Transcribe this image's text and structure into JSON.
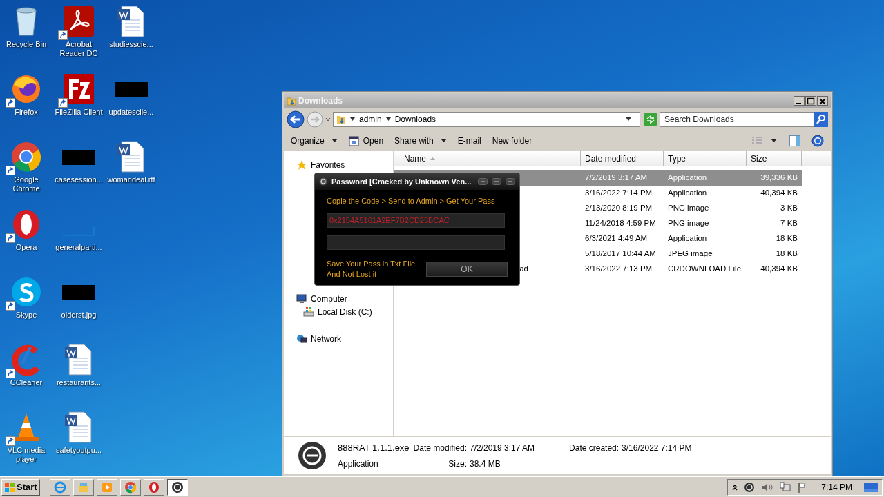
{
  "desktop": {
    "columns": [
      [
        {
          "label": "Recycle Bin",
          "kind": "recycle",
          "shortcut": false
        },
        {
          "label": "Firefox",
          "kind": "firefox",
          "shortcut": true
        },
        {
          "label": "Google Chrome",
          "kind": "chrome",
          "shortcut": true
        },
        {
          "label": "Opera",
          "kind": "opera",
          "shortcut": true
        },
        {
          "label": "Skype",
          "kind": "skype",
          "shortcut": true
        },
        {
          "label": "CCleaner",
          "kind": "ccleaner",
          "shortcut": true
        },
        {
          "label": "VLC media player",
          "kind": "vlc",
          "shortcut": true
        }
      ],
      [
        {
          "label": "Acrobat Reader DC",
          "kind": "pdf",
          "shortcut": true
        },
        {
          "label": "FileZilla Client",
          "kind": "filezilla",
          "shortcut": true
        },
        {
          "label": "casesession...",
          "kind": "redacted",
          "shortcut": false
        },
        {
          "label": "generalparti...",
          "kind": "blank",
          "shortcut": false
        },
        {
          "label": "olderst.jpg",
          "kind": "redacted",
          "shortcut": false
        },
        {
          "label": "restaurants...",
          "kind": "word",
          "shortcut": false
        },
        {
          "label": "safetyoutpu...",
          "kind": "word",
          "shortcut": false
        }
      ],
      [
        {
          "label": "studiesscie...",
          "kind": "word",
          "shortcut": false
        },
        {
          "label": "updatesclie...",
          "kind": "redacted",
          "shortcut": false
        },
        {
          "label": "womandeal.rtf",
          "kind": "word",
          "shortcut": false
        }
      ]
    ]
  },
  "explorer": {
    "title": "Downloads",
    "breadcrumb": [
      "admin",
      "Downloads"
    ],
    "search": {
      "placeholder": "Search Downloads"
    },
    "toolbar": [
      {
        "label": "Organize",
        "kind": "menu"
      },
      {
        "label": "Open",
        "kind": "open"
      },
      {
        "label": "Share with",
        "kind": "menu"
      },
      {
        "label": "E-mail",
        "kind": "plain"
      },
      {
        "label": "New folder",
        "kind": "plain"
      }
    ],
    "nav": [
      {
        "label": "Favorites",
        "kind": "star"
      },
      {
        "label": "Computer",
        "kind": "computer",
        "children": [
          {
            "label": "Local Disk (C:)",
            "kind": "disk"
          }
        ]
      },
      {
        "label": "Network",
        "kind": "network"
      }
    ],
    "columns": [
      "Name",
      "Date modified",
      "Type",
      "Size"
    ],
    "rows": [
      {
        "date": "7/2/2019 3:17 AM",
        "type": "Application",
        "size": "39,336 KB",
        "selected": true
      },
      {
        "date": "3/16/2022 7:14 PM",
        "type": "Application",
        "size": "40,394 KB",
        "selected": false
      },
      {
        "date": "2/13/2020 8:19 PM",
        "type": "PNG image",
        "size": "3 KB",
        "selected": false
      },
      {
        "date": "11/24/2018 4:59 PM",
        "type": "PNG image",
        "size": "7 KB",
        "selected": false
      },
      {
        "date": "6/3/2021 4:49 AM",
        "type": "Application",
        "size": "18 KB",
        "selected": false
      },
      {
        "date": "5/18/2017 10:44 AM",
        "type": "JPEG image",
        "size": "18 KB",
        "selected": false
      },
      {
        "name": "ad",
        "date": "3/16/2022 7:13 PM",
        "type": "CRDOWNLOAD File",
        "size": "40,394 KB",
        "selected": false
      }
    ],
    "details": {
      "name": "888RAT 1.1.1.exe",
      "type": "Application",
      "fields": [
        {
          "label": "Date modified:",
          "value": "7/2/2019 3:17 AM"
        },
        {
          "label": "Date created:",
          "value": "3/16/2022 7:14 PM"
        },
        {
          "label": "Size:",
          "value": "38.4 MB"
        }
      ]
    }
  },
  "dialog": {
    "title": "Password [Cracked by Unknown Ven...",
    "instruction": "Copie the Code > Send to Admin > Get Your Pass",
    "code": "0x2154A5161A2EF7B2CD25BCAC",
    "note": [
      "Save Your Pass in Txt File",
      "And Not Lost it"
    ],
    "button": "OK"
  },
  "taskbar": {
    "start": "Start",
    "apps": [
      {
        "kind": "ie",
        "active": false
      },
      {
        "kind": "explorer",
        "active": false
      },
      {
        "kind": "media",
        "active": false
      },
      {
        "kind": "chrome",
        "active": false
      },
      {
        "kind": "opera",
        "active": false
      },
      {
        "kind": "rat",
        "active": true
      }
    ],
    "clock": "7:14 PM"
  }
}
